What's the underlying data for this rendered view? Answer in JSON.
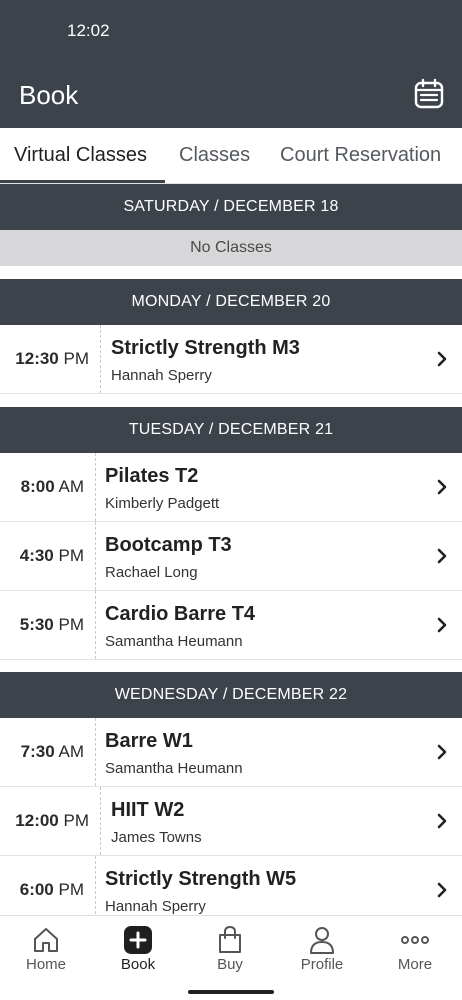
{
  "status_bar": {
    "time": "12:02"
  },
  "header": {
    "title": "Book",
    "calendar_icon": "calendar-icon"
  },
  "tabs": [
    {
      "label": "Virtual Classes",
      "active": true
    },
    {
      "label": "Classes",
      "active": false
    },
    {
      "label": "Court Reservation",
      "active": false
    }
  ],
  "days": [
    {
      "heading": "SATURDAY / DECEMBER 18",
      "empty_text": "No Classes",
      "classes": []
    },
    {
      "heading": "MONDAY / DECEMBER 20",
      "classes": [
        {
          "time": "12:30",
          "period": "PM",
          "name": "Strictly Strength M3",
          "instructor": "Hannah Sperry"
        }
      ]
    },
    {
      "heading": "TUESDAY / DECEMBER 21",
      "classes": [
        {
          "time": "8:00",
          "period": "AM",
          "name": "Pilates T2",
          "instructor": "Kimberly Padgett"
        },
        {
          "time": "4:30",
          "period": "PM",
          "name": "Bootcamp T3",
          "instructor": "Rachael Long"
        },
        {
          "time": "5:30",
          "period": "PM",
          "name": "Cardio Barre T4",
          "instructor": "Samantha Heumann"
        }
      ]
    },
    {
      "heading": "WEDNESDAY / DECEMBER 22",
      "classes": [
        {
          "time": "7:30",
          "period": "AM",
          "name": "Barre W1",
          "instructor": "Samantha Heumann"
        },
        {
          "time": "12:00",
          "period": "PM",
          "name": "HIIT W2",
          "instructor": "James Towns"
        },
        {
          "time": "6:00",
          "period": "PM",
          "name": "Strictly Strength W5",
          "instructor": "Hannah Sperry"
        }
      ]
    }
  ],
  "bottom_nav": [
    {
      "label": "Home",
      "icon": "home-icon",
      "active": false
    },
    {
      "label": "Book",
      "icon": "plus-icon",
      "active": true
    },
    {
      "label": "Buy",
      "icon": "shopping-bag-icon",
      "active": false
    },
    {
      "label": "Profile",
      "icon": "person-icon",
      "active": false
    },
    {
      "label": "More",
      "icon": "more-icon",
      "active": false
    }
  ],
  "colors": {
    "header_bg": "#3d434b",
    "no_classes_bg": "#d7d7d9",
    "text": "#1f1f1f"
  }
}
